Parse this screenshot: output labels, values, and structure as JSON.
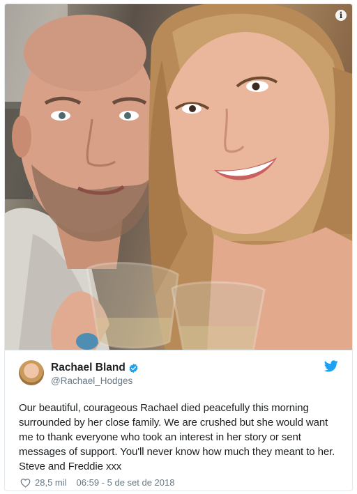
{
  "photo": {
    "alt_icon": "info-icon",
    "info_label": "i"
  },
  "tweet": {
    "author": {
      "display_name": "Rachael Bland",
      "handle": "@Rachael_Hodges",
      "verified": true
    },
    "brand_icon": "twitter-bird-icon",
    "text": "Our beautiful, courageous Rachael died peacefully this morning surrounded by her close family. We are crushed but she would want me to thank everyone who took an interest in her story or sent messages of support. You'll never know how much they meant to her. Steve and Freddie xxx",
    "likes": "28,5 mil",
    "timestamp": "06:59 - 5 de set de 2018"
  },
  "colors": {
    "twitter_blue": "#1da1f2",
    "meta_gray": "#697882",
    "text": "#1c2022",
    "border": "#e1e8ed"
  }
}
